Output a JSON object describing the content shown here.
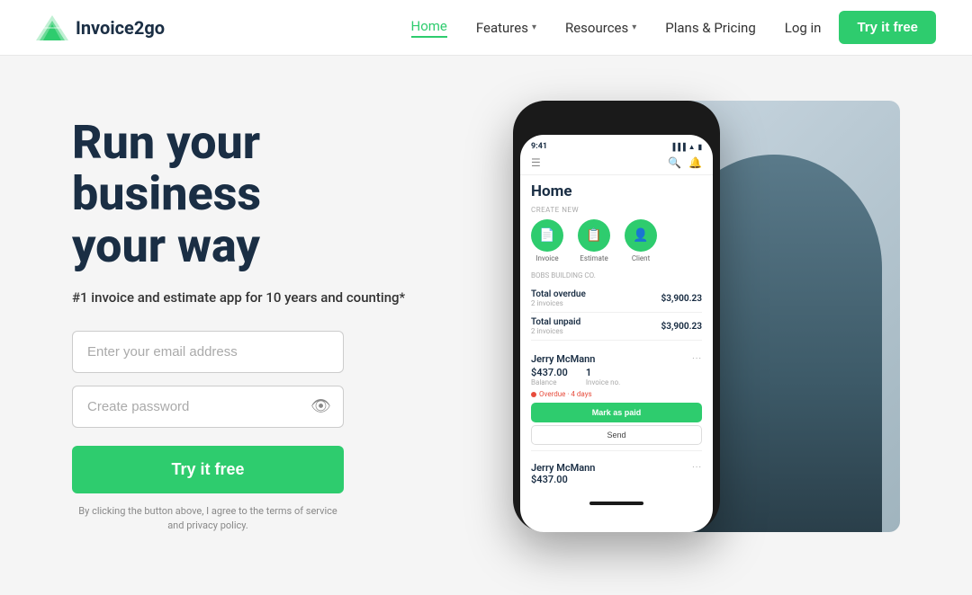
{
  "nav": {
    "logo_text": "Invoice2go",
    "links": [
      {
        "label": "Home",
        "active": true
      },
      {
        "label": "Features",
        "has_chevron": true
      },
      {
        "label": "Resources",
        "has_chevron": true
      },
      {
        "label": "Plans & Pricing",
        "has_chevron": false
      }
    ],
    "login_label": "Log in",
    "try_btn_label": "Try it free"
  },
  "hero": {
    "headline_line1": "Run your",
    "headline_line2": "business",
    "headline_line3": "your way",
    "subtext": "#1 invoice and estimate app for 10 years and counting*",
    "email_placeholder": "Enter your email address",
    "password_placeholder": "Create password",
    "try_btn_label": "Try it free",
    "terms_text": "By clicking the button above, I agree to the terms of service and privacy policy."
  },
  "phone": {
    "status_time": "9:41",
    "home_title": "Home",
    "create_new_label": "CREATE NEW",
    "create_icons": [
      {
        "icon": "📄",
        "label": "Invoice"
      },
      {
        "icon": "📋",
        "label": "Estimate"
      },
      {
        "icon": "👤",
        "label": "Client"
      }
    ],
    "company": "BOBS BUILDING CO.",
    "stats": [
      {
        "label": "Total overdue",
        "sub": "2 invoices",
        "value": "$3,900.23"
      },
      {
        "label": "Total unpaid",
        "sub": "2 invoices",
        "value": "$3,900.23"
      }
    ],
    "client_card": {
      "name": "Jerry McMann",
      "balance": "$437.00",
      "balance_label": "Balance",
      "invoices": "1",
      "invoices_label": "Invoice no.",
      "overdue": "Overdue · 4 days",
      "mark_paid": "Mark as paid",
      "send": "Send"
    },
    "client_card2": {
      "name": "Jerry McMann",
      "balance": "$437.00"
    }
  }
}
